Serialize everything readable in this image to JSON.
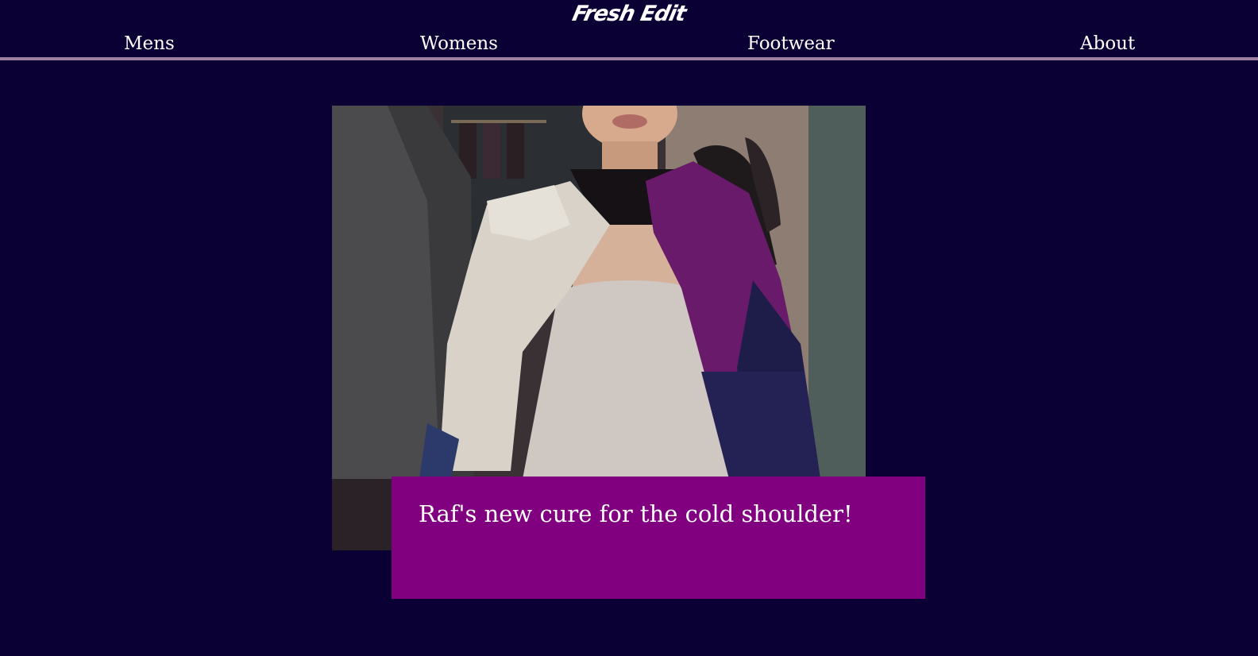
{
  "brand": {
    "logo_text": "Fresh Edit"
  },
  "nav": {
    "items": [
      {
        "label": "Mens"
      },
      {
        "label": "Womens"
      },
      {
        "label": "Footwear"
      },
      {
        "label": "About"
      }
    ]
  },
  "hero": {
    "caption": "Raf's new cure for the cold shoulder!"
  },
  "colors": {
    "background": "#0b0033",
    "caption_box": "#800080",
    "nav_underline": "#9a7f9e",
    "text": "#ffffff"
  }
}
